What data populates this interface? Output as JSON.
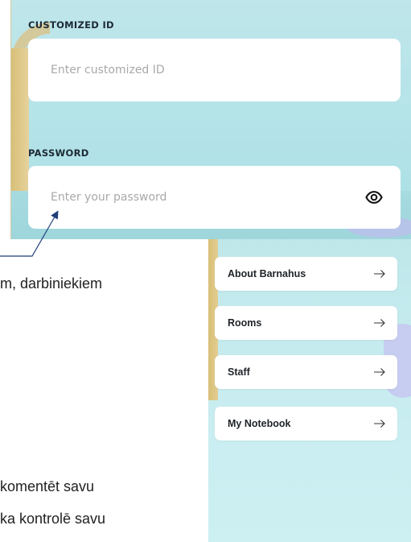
{
  "login": {
    "customized_id": {
      "label": "CUSTOMIZED ID",
      "placeholder": "Enter customized ID"
    },
    "password": {
      "label": "PASSWORD",
      "placeholder": "Enter your password",
      "toggle_icon": "eye-icon"
    }
  },
  "document": {
    "lines": [
      "m, darbiniekiem",
      "komentēt savu",
      "ka kontrolē savu"
    ]
  },
  "menu": {
    "items": [
      {
        "label": "About Barnahus",
        "icon": "arrow-right-icon"
      },
      {
        "label": "Rooms",
        "icon": "arrow-right-icon"
      },
      {
        "label": "Staff",
        "icon": "arrow-right-icon"
      },
      {
        "label": "My Notebook",
        "icon": "arrow-right-icon"
      }
    ]
  },
  "colors": {
    "panel_bg": "#b3e3e8",
    "arrow": "#1e3f7a",
    "text": "#1d2a35"
  }
}
